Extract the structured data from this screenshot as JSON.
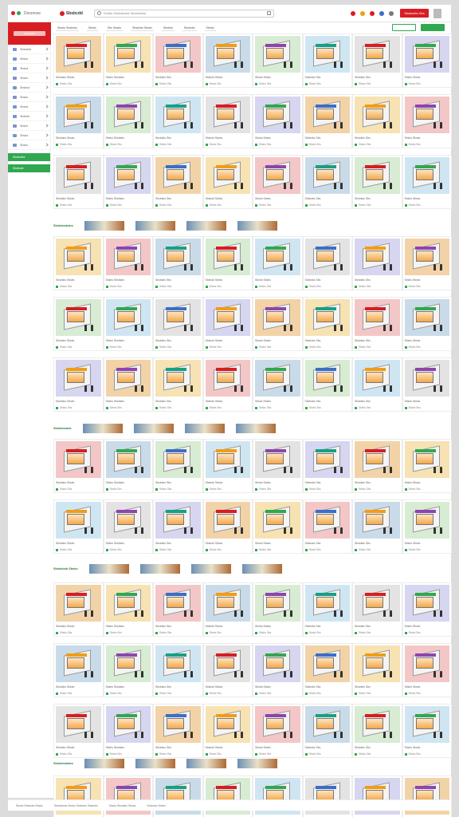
{
  "header": {
    "app_brand": "Dsoonow",
    "brand": "Sbsbcdd",
    "search_placeholder": "Ssdbs Sbsbabsbd Sbsdbsbsd",
    "cta_label": "Sbsbsdbs Sbs"
  },
  "sidebar": {
    "title": "Sbsbsbsd",
    "items": [
      {
        "label": "Sbsbdde"
      },
      {
        "label": "Sbsbs"
      },
      {
        "label": "Sbsbd"
      },
      {
        "label": "Sbsbs"
      },
      {
        "label": "Sbsbsd"
      },
      {
        "label": "Sbsbs"
      },
      {
        "label": "Sbsbd"
      },
      {
        "label": "Sbsbsb"
      },
      {
        "label": "Sbsbs"
      },
      {
        "label": "Sbsbd"
      },
      {
        "label": "Sbsbs"
      }
    ],
    "green_items": [
      {
        "label": "Sbsbsdbs"
      },
      {
        "label": "Sbsbsdb"
      }
    ]
  },
  "filters": [
    "Sbsbs Sbsbsbs",
    "Sbsbs",
    "Sbs Sbsbs",
    "Sbsbsbs Sbsbs",
    "Sbsbsb",
    "Sbsbsbs",
    "Sbsbs"
  ],
  "toolbar": {
    "btn1": "",
    "btn2": "Sbsbsbsbsbs"
  },
  "products": {
    "titles": [
      "Sbsbsbs Sbsbs",
      "Sbsbs Sbsbsbs",
      "Sbsbsbs Sbs",
      "Sbsbsb Sbsbs",
      "Sbsbs Sbsbs",
      "Sbsbsbs Sbs",
      "Sbsbsbs Sbs",
      "Sbsbs Sbsbs"
    ],
    "meta": "Sbsbs Sbs"
  },
  "sections": [
    "Sbsbsbsbsbs",
    "Sbsbsbsbsb",
    "Sbsbsbsb Sbsbs",
    "Sbsbsbsbsbs"
  ],
  "footer": [
    "Sbsbs Sbsbsbs Sbsbs",
    "Sbsbsbsbs Sbsbs Sbsbsbs Sbsbsbs",
    "Sbsbs Sbsbsbs Sbsbs",
    "Sbsbsbs Sbsbs"
  ],
  "colors": {
    "accent": "#d81d22",
    "green": "#2fa84f"
  }
}
